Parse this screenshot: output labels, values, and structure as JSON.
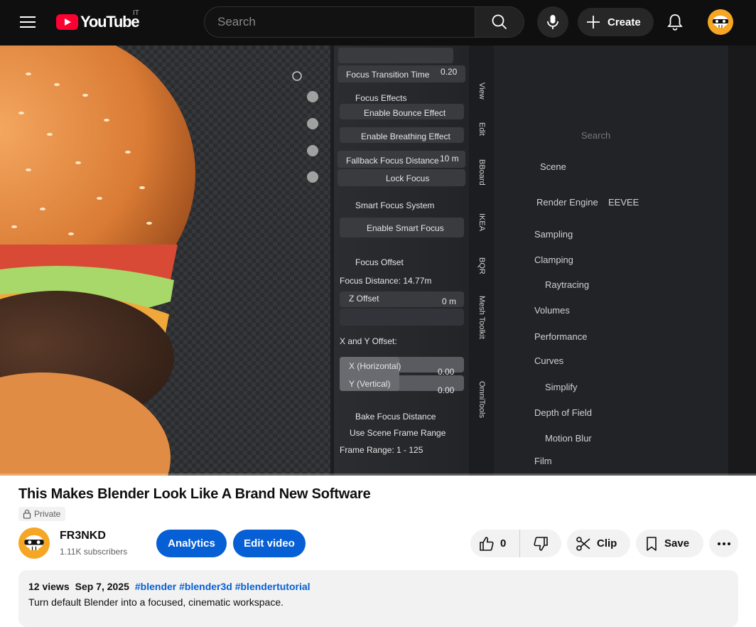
{
  "header": {
    "logo_text": "YouTube",
    "country_code": "IT",
    "search_placeholder": "Search",
    "create_label": "Create"
  },
  "player": {
    "frame": {
      "panel_left": [
        {
          "label": "Focus Transition Time",
          "value": "0.20"
        },
        {
          "label": "Focus Effects"
        },
        {
          "label": "Enable Bounce Effect"
        },
        {
          "label": "Enable Breathing Effect"
        },
        {
          "label": "Fallback Focus Distance",
          "value": "10 m"
        },
        {
          "label": "Lock Focus"
        },
        {
          "label": "Smart Focus System"
        },
        {
          "label": "Enable Smart Focus"
        },
        {
          "label": "Focus Offset"
        },
        {
          "label": "Focus Distance: 14.77m"
        },
        {
          "label": "Z Offset",
          "value": "0 m"
        },
        {
          "label": "X and Y Offset:"
        },
        {
          "label": "X (Horizontal)",
          "value": "0.00"
        },
        {
          "label": "Y (Vertical)",
          "value": "0.00"
        },
        {
          "label": "Bake Focus Distance"
        },
        {
          "label": "Use Scene Frame Range"
        },
        {
          "label": "Frame Range: 1 - 125"
        }
      ],
      "vertical_tabs": [
        "View",
        "Edit",
        "BBoard",
        "IKEA",
        "BQR",
        "Mesh Toolkit",
        "OmniTools"
      ],
      "right_panel": {
        "search_placeholder": "Search",
        "scene_label": "Scene",
        "render_engine_label": "Render Engine",
        "render_engine_value": "EEVEE",
        "sections": [
          "Sampling",
          "Clamping",
          "Raytracing",
          "Volumes",
          "Performance",
          "Curves",
          "Simplify",
          "Depth of Field",
          "Motion Blur",
          "Film"
        ]
      }
    }
  },
  "video": {
    "title": "This Makes Blender Look Like A Brand New Software",
    "privacy": "Private"
  },
  "channel": {
    "name": "FR3NKD",
    "subscribers": "1.11K subscribers"
  },
  "actions": {
    "analytics": "Analytics",
    "edit_video": "Edit video",
    "like_count": "0",
    "clip": "Clip",
    "save": "Save"
  },
  "description": {
    "views": "12 views",
    "date": "Sep 7, 2025",
    "tags": "#blender #blender3d #blendertutorial",
    "text": "Turn default Blender into a focused, cinematic workspace."
  }
}
